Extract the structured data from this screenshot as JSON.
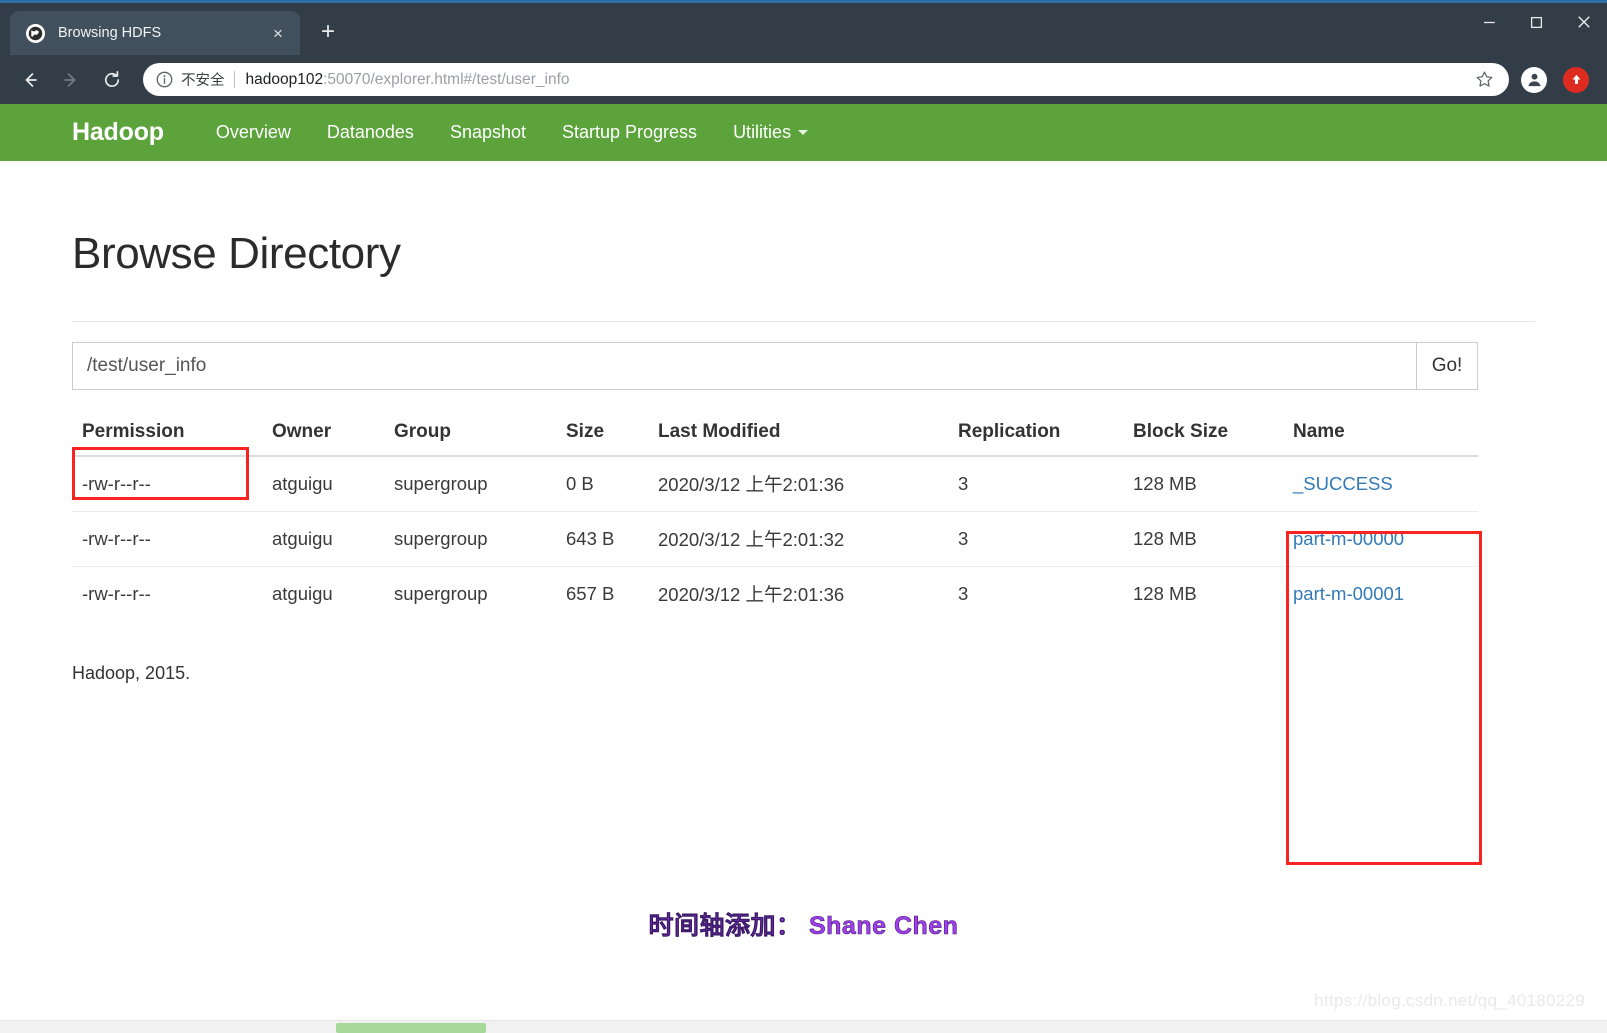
{
  "browser": {
    "tab": {
      "title": "Browsing HDFS",
      "favicon_name": "globe-icon",
      "close_label": "×"
    },
    "newtab_label": "+",
    "window_controls": {
      "minimize": "—",
      "maximize": "□",
      "close": "✕"
    },
    "toolbar": {
      "back_label": "←",
      "forward_label": "→",
      "reload_label": "↻",
      "security_text": "不安全",
      "url_host": "hadoop102",
      "url_rest": ":50070/explorer.html#/test/user_info",
      "url_full": "hadoop102:50070/explorer.html#/test/user_info",
      "star_label": "☆",
      "profile_name": "profile-avatar-icon",
      "update_name": "update-arrow-icon"
    }
  },
  "hadoop_nav": {
    "brand": "Hadoop",
    "items": [
      {
        "label": "Overview",
        "has_caret": false
      },
      {
        "label": "Datanodes",
        "has_caret": false
      },
      {
        "label": "Snapshot",
        "has_caret": false
      },
      {
        "label": "Startup Progress",
        "has_caret": false
      },
      {
        "label": "Utilities",
        "has_caret": true
      }
    ]
  },
  "page": {
    "title": "Browse Directory",
    "path_value": "/test/user_info",
    "path_placeholder": "",
    "go_label": "Go!",
    "footer": "Hadoop, 2015.",
    "signature": "时间轴添加： Shane Chen",
    "watermark": "https://blog.csdn.net/qq_40180229"
  },
  "table": {
    "headers": [
      "Permission",
      "Owner",
      "Group",
      "Size",
      "Last Modified",
      "Replication",
      "Block Size",
      "Name"
    ],
    "rows": [
      {
        "permission": "-rw-r--r--",
        "owner": "atguigu",
        "group": "supergroup",
        "size": "0 B",
        "last_modified": "2020/3/12 上午2:01:36",
        "replication": "3",
        "block_size": "128 MB",
        "name": "_SUCCESS"
      },
      {
        "permission": "-rw-r--r--",
        "owner": "atguigu",
        "group": "supergroup",
        "size": "643 B",
        "last_modified": "2020/3/12 上午2:01:32",
        "replication": "3",
        "block_size": "128 MB",
        "name": "part-m-00000"
      },
      {
        "permission": "-rw-r--r--",
        "owner": "atguigu",
        "group": "supergroup",
        "size": "657 B",
        "last_modified": "2020/3/12 上午2:01:36",
        "replication": "3",
        "block_size": "128 MB",
        "name": "part-m-00001"
      }
    ]
  },
  "colors": {
    "navbar_green": "#5ca33c",
    "link_blue": "#337ab7",
    "annotation_red": "#fb2222",
    "signature_purple": "#a23df0",
    "chrome_dark": "#323d47"
  }
}
